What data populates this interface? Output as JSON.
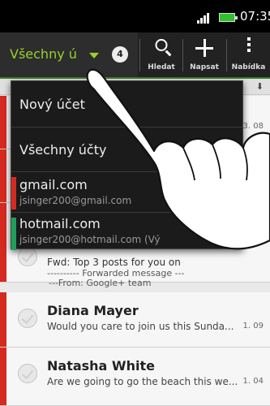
{
  "status_bar": {
    "time": "07:35",
    "signal_icon": "signal-icon",
    "battery_icon": "battery-icon"
  },
  "action_bar": {
    "account_selector": "Všechny ú",
    "unread_count": "4",
    "search_label": "Hledat",
    "compose_label": "Napsat",
    "menu_label": "Nabídka",
    "accent_color": "#98d12b"
  },
  "dropdown": {
    "items": [
      {
        "label": "Nový účet"
      },
      {
        "label": "Všechny účty"
      },
      {
        "label": "gmail.com",
        "sub": "jsinger200@gmail.com",
        "color": "#d62a20"
      },
      {
        "label": "hotmail.com",
        "sub": "jsinger200@hotmail.com (Vý",
        "color": "#1ea05a"
      }
    ]
  },
  "mail_list": {
    "peek_date": "3. 08",
    "rows": [
      {
        "line1": "Fwd: Top 3 posts for you on",
        "line2": "---------- Forwarded message ---",
        "line3": "---From: Google+ team",
        "color": "#d62a20"
      },
      {
        "sender": "Diana Mayer",
        "snippet": "Would you care to join us this Sunda...",
        "date": "1. 09",
        "color": "#d62a20"
      },
      {
        "sender": "Natasha White",
        "snippet": "Are we going to go the beach this we...",
        "date": "1. 04",
        "color": "#d62a20"
      }
    ]
  }
}
